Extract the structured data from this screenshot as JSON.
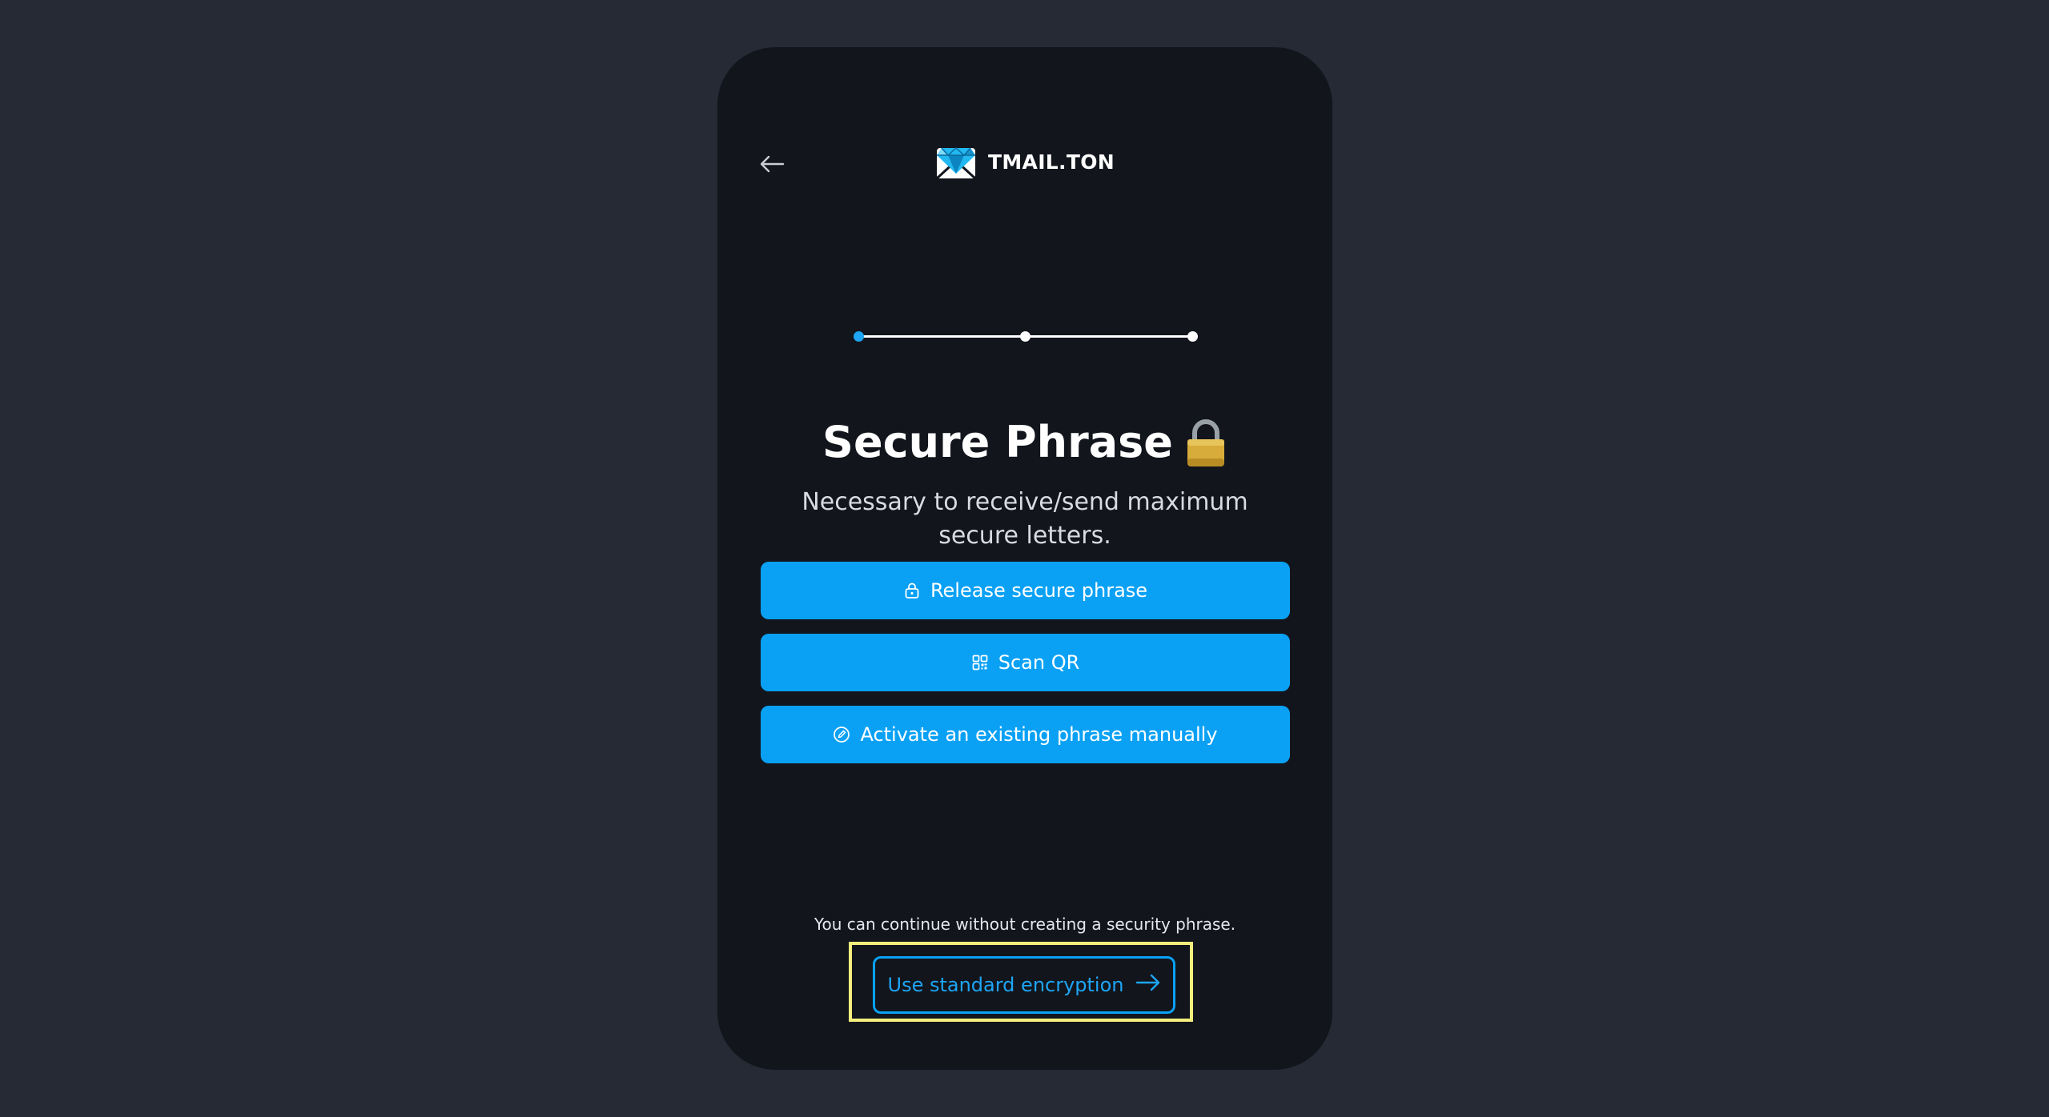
{
  "header": {
    "back_icon": "arrow-left-icon",
    "brand_name": "TMAIL.TON",
    "brand_logo": "diamond-envelope-logo"
  },
  "stepper": {
    "total_steps": 3,
    "current_step": 1,
    "active_color": "#1ea5f5"
  },
  "main": {
    "title": "Secure Phrase",
    "title_icon": "lock-emoji",
    "subtitle": "Necessary to receive/send maximum secure letters."
  },
  "actions": [
    {
      "label": "Release secure phrase",
      "icon": "lock-icon"
    },
    {
      "label": "Scan QR",
      "icon": "qr-code-icon"
    },
    {
      "label": "Activate an existing phrase manually",
      "icon": "edit-icon"
    }
  ],
  "footer": {
    "note": "You can continue without creating a security phrase.",
    "standard_button_label": "Use standard encryption",
    "standard_button_icon": "arrow-right-icon"
  },
  "colors": {
    "page_background": "#252a35",
    "card_background": "#12151c",
    "accent": "#0aa1f5",
    "highlight": "#f4ee7c"
  }
}
